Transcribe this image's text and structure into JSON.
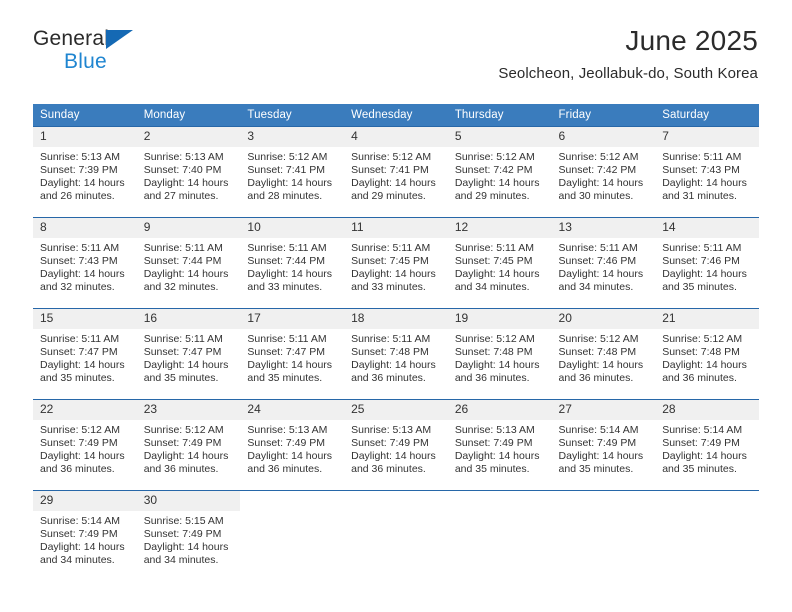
{
  "brand": {
    "line1": "General",
    "line2": "Blue",
    "triangle_color": "#1569b4",
    "line2_color": "#1f85d0"
  },
  "header": {
    "title": "June 2025",
    "subtitle": "Seolcheon, Jeollabuk-do, South Korea"
  },
  "theme": {
    "header_bg": "#3a7cbd",
    "row_rule": "#2767a8",
    "daynum_bg": "#f0f0f0",
    "text": "#333333"
  },
  "calendar": {
    "weekday_headers": [
      "Sunday",
      "Monday",
      "Tuesday",
      "Wednesday",
      "Thursday",
      "Friday",
      "Saturday"
    ],
    "weeks": [
      [
        {
          "day": "1",
          "sunrise": "Sunrise: 5:13 AM",
          "sunset": "Sunset: 7:39 PM",
          "daylight": "Daylight: 14 hours and 26 minutes."
        },
        {
          "day": "2",
          "sunrise": "Sunrise: 5:13 AM",
          "sunset": "Sunset: 7:40 PM",
          "daylight": "Daylight: 14 hours and 27 minutes."
        },
        {
          "day": "3",
          "sunrise": "Sunrise: 5:12 AM",
          "sunset": "Sunset: 7:41 PM",
          "daylight": "Daylight: 14 hours and 28 minutes."
        },
        {
          "day": "4",
          "sunrise": "Sunrise: 5:12 AM",
          "sunset": "Sunset: 7:41 PM",
          "daylight": "Daylight: 14 hours and 29 minutes."
        },
        {
          "day": "5",
          "sunrise": "Sunrise: 5:12 AM",
          "sunset": "Sunset: 7:42 PM",
          "daylight": "Daylight: 14 hours and 29 minutes."
        },
        {
          "day": "6",
          "sunrise": "Sunrise: 5:12 AM",
          "sunset": "Sunset: 7:42 PM",
          "daylight": "Daylight: 14 hours and 30 minutes."
        },
        {
          "day": "7",
          "sunrise": "Sunrise: 5:11 AM",
          "sunset": "Sunset: 7:43 PM",
          "daylight": "Daylight: 14 hours and 31 minutes."
        }
      ],
      [
        {
          "day": "8",
          "sunrise": "Sunrise: 5:11 AM",
          "sunset": "Sunset: 7:43 PM",
          "daylight": "Daylight: 14 hours and 32 minutes."
        },
        {
          "day": "9",
          "sunrise": "Sunrise: 5:11 AM",
          "sunset": "Sunset: 7:44 PM",
          "daylight": "Daylight: 14 hours and 32 minutes."
        },
        {
          "day": "10",
          "sunrise": "Sunrise: 5:11 AM",
          "sunset": "Sunset: 7:44 PM",
          "daylight": "Daylight: 14 hours and 33 minutes."
        },
        {
          "day": "11",
          "sunrise": "Sunrise: 5:11 AM",
          "sunset": "Sunset: 7:45 PM",
          "daylight": "Daylight: 14 hours and 33 minutes."
        },
        {
          "day": "12",
          "sunrise": "Sunrise: 5:11 AM",
          "sunset": "Sunset: 7:45 PM",
          "daylight": "Daylight: 14 hours and 34 minutes."
        },
        {
          "day": "13",
          "sunrise": "Sunrise: 5:11 AM",
          "sunset": "Sunset: 7:46 PM",
          "daylight": "Daylight: 14 hours and 34 minutes."
        },
        {
          "day": "14",
          "sunrise": "Sunrise: 5:11 AM",
          "sunset": "Sunset: 7:46 PM",
          "daylight": "Daylight: 14 hours and 35 minutes."
        }
      ],
      [
        {
          "day": "15",
          "sunrise": "Sunrise: 5:11 AM",
          "sunset": "Sunset: 7:47 PM",
          "daylight": "Daylight: 14 hours and 35 minutes."
        },
        {
          "day": "16",
          "sunrise": "Sunrise: 5:11 AM",
          "sunset": "Sunset: 7:47 PM",
          "daylight": "Daylight: 14 hours and 35 minutes."
        },
        {
          "day": "17",
          "sunrise": "Sunrise: 5:11 AM",
          "sunset": "Sunset: 7:47 PM",
          "daylight": "Daylight: 14 hours and 35 minutes."
        },
        {
          "day": "18",
          "sunrise": "Sunrise: 5:11 AM",
          "sunset": "Sunset: 7:48 PM",
          "daylight": "Daylight: 14 hours and 36 minutes."
        },
        {
          "day": "19",
          "sunrise": "Sunrise: 5:12 AM",
          "sunset": "Sunset: 7:48 PM",
          "daylight": "Daylight: 14 hours and 36 minutes."
        },
        {
          "day": "20",
          "sunrise": "Sunrise: 5:12 AM",
          "sunset": "Sunset: 7:48 PM",
          "daylight": "Daylight: 14 hours and 36 minutes."
        },
        {
          "day": "21",
          "sunrise": "Sunrise: 5:12 AM",
          "sunset": "Sunset: 7:48 PM",
          "daylight": "Daylight: 14 hours and 36 minutes."
        }
      ],
      [
        {
          "day": "22",
          "sunrise": "Sunrise: 5:12 AM",
          "sunset": "Sunset: 7:49 PM",
          "daylight": "Daylight: 14 hours and 36 minutes."
        },
        {
          "day": "23",
          "sunrise": "Sunrise: 5:12 AM",
          "sunset": "Sunset: 7:49 PM",
          "daylight": "Daylight: 14 hours and 36 minutes."
        },
        {
          "day": "24",
          "sunrise": "Sunrise: 5:13 AM",
          "sunset": "Sunset: 7:49 PM",
          "daylight": "Daylight: 14 hours and 36 minutes."
        },
        {
          "day": "25",
          "sunrise": "Sunrise: 5:13 AM",
          "sunset": "Sunset: 7:49 PM",
          "daylight": "Daylight: 14 hours and 36 minutes."
        },
        {
          "day": "26",
          "sunrise": "Sunrise: 5:13 AM",
          "sunset": "Sunset: 7:49 PM",
          "daylight": "Daylight: 14 hours and 35 minutes."
        },
        {
          "day": "27",
          "sunrise": "Sunrise: 5:14 AM",
          "sunset": "Sunset: 7:49 PM",
          "daylight": "Daylight: 14 hours and 35 minutes."
        },
        {
          "day": "28",
          "sunrise": "Sunrise: 5:14 AM",
          "sunset": "Sunset: 7:49 PM",
          "daylight": "Daylight: 14 hours and 35 minutes."
        }
      ],
      [
        {
          "day": "29",
          "sunrise": "Sunrise: 5:14 AM",
          "sunset": "Sunset: 7:49 PM",
          "daylight": "Daylight: 14 hours and 34 minutes."
        },
        {
          "day": "30",
          "sunrise": "Sunrise: 5:15 AM",
          "sunset": "Sunset: 7:49 PM",
          "daylight": "Daylight: 14 hours and 34 minutes."
        },
        {
          "day": "",
          "sunrise": "",
          "sunset": "",
          "daylight": ""
        },
        {
          "day": "",
          "sunrise": "",
          "sunset": "",
          "daylight": ""
        },
        {
          "day": "",
          "sunrise": "",
          "sunset": "",
          "daylight": ""
        },
        {
          "day": "",
          "sunrise": "",
          "sunset": "",
          "daylight": ""
        },
        {
          "day": "",
          "sunrise": "",
          "sunset": "",
          "daylight": ""
        }
      ]
    ]
  }
}
